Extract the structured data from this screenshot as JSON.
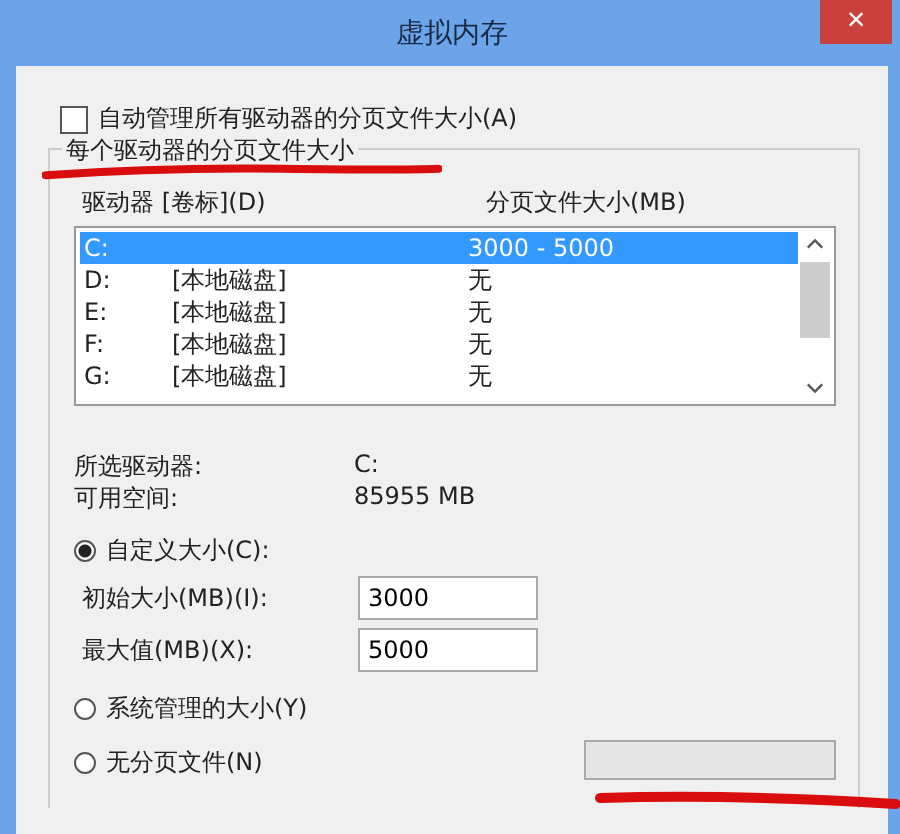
{
  "window": {
    "title": "虚拟内存",
    "close": "×"
  },
  "auto_manage": {
    "label": "自动管理所有驱动器的分页文件大小(A)",
    "checked": false
  },
  "group": {
    "title": "每个驱动器的分页文件大小",
    "columns": [
      "驱动器 [卷标](D)",
      "分页文件大小(MB)"
    ],
    "rows": [
      {
        "drive": "C:",
        "label": "",
        "size": "3000 - 5000",
        "selected": true
      },
      {
        "drive": "D:",
        "label": "[本地磁盘]",
        "size": "无",
        "selected": false
      },
      {
        "drive": "E:",
        "label": "[本地磁盘]",
        "size": "无",
        "selected": false
      },
      {
        "drive": "F:",
        "label": "[本地磁盘]",
        "size": "无",
        "selected": false
      },
      {
        "drive": "G:",
        "label": "[本地磁盘]",
        "size": "无",
        "selected": false
      }
    ],
    "info": [
      {
        "label": "所选驱动器:",
        "value": "C:"
      },
      {
        "label": "可用空间:",
        "value": "85955 MB"
      }
    ],
    "custom": {
      "label": "自定义大小(C):",
      "selected": true
    },
    "fields": [
      {
        "label": "初始大小(MB)(I):",
        "value": "3000"
      },
      {
        "label": "最大值(MB)(X):",
        "value": "5000"
      }
    ],
    "options": [
      {
        "label": "系统管理的大小(Y)",
        "selected": false
      },
      {
        "label": "无分页文件(N)",
        "selected": false
      }
    ]
  }
}
